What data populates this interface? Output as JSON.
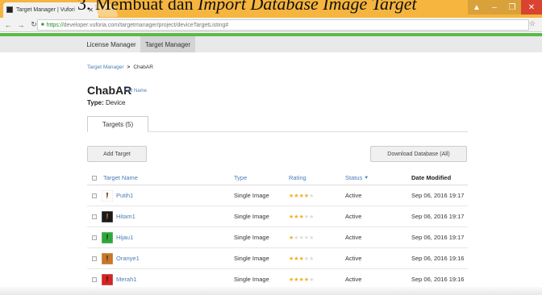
{
  "doc_overlay": {
    "prefix": "3.    Membuat dan ",
    "italic": "Import Database Image Target"
  },
  "browser": {
    "tab_title": "Target Manager | Vufori",
    "url_scheme": "https://",
    "url_rest": "developer.vuforia.com/targetmanager/project/deviceTargetListing#"
  },
  "topnav": {
    "license_label": "License Manager",
    "target_label": "Target Manager"
  },
  "breadcrumb": {
    "parent": "Target Manager",
    "separator": ">",
    "current": "ChabAR"
  },
  "project": {
    "title": "ChabAR",
    "edit_label": "Edit Name",
    "type_label": "Type:",
    "type_value": "Device"
  },
  "tabs": {
    "targets_label": "Targets (5)"
  },
  "buttons": {
    "add_target": "Add Target",
    "download_db": "Download Database (All)"
  },
  "table": {
    "headers": {
      "name": "Target Name",
      "type": "Type",
      "rating": "Rating",
      "status": "Status",
      "date": "Date Modified"
    },
    "rows": [
      {
        "name": "Putih1",
        "type": "Single Image",
        "rating": 4,
        "status": "Active",
        "date": "Sep 06, 2016 19:17",
        "thumb_color": "#ffffff",
        "thumb_mark": "#7a3b1e"
      },
      {
        "name": "Hitam1",
        "type": "Single Image",
        "rating": 3,
        "status": "Active",
        "date": "Sep 06, 2016 19:17",
        "thumb_color": "#1a1a1a",
        "thumb_mark": "#b5651d"
      },
      {
        "name": "Hijau1",
        "type": "Single Image",
        "rating": 1,
        "status": "Active",
        "date": "Sep 06, 2016 19:17",
        "thumb_color": "#2fa83a",
        "thumb_mark": "#1a4a1a"
      },
      {
        "name": "Oranye1",
        "type": "Single Image",
        "rating": 3,
        "status": "Active",
        "date": "Sep 06, 2016 19:16",
        "thumb_color": "#c8762a",
        "thumb_mark": "#6b3510"
      },
      {
        "name": "Merah1",
        "type": "Single Image",
        "rating": 4,
        "status": "Active",
        "date": "Sep 06, 2016 19:16",
        "thumb_color": "#d42424",
        "thumb_mark": "#5a0f0f"
      }
    ]
  },
  "colors": {
    "accent_link": "#4a7db8",
    "brand_green": "#5bb947",
    "star_on": "#f2b01e",
    "star_off": "#dcdcdc"
  }
}
